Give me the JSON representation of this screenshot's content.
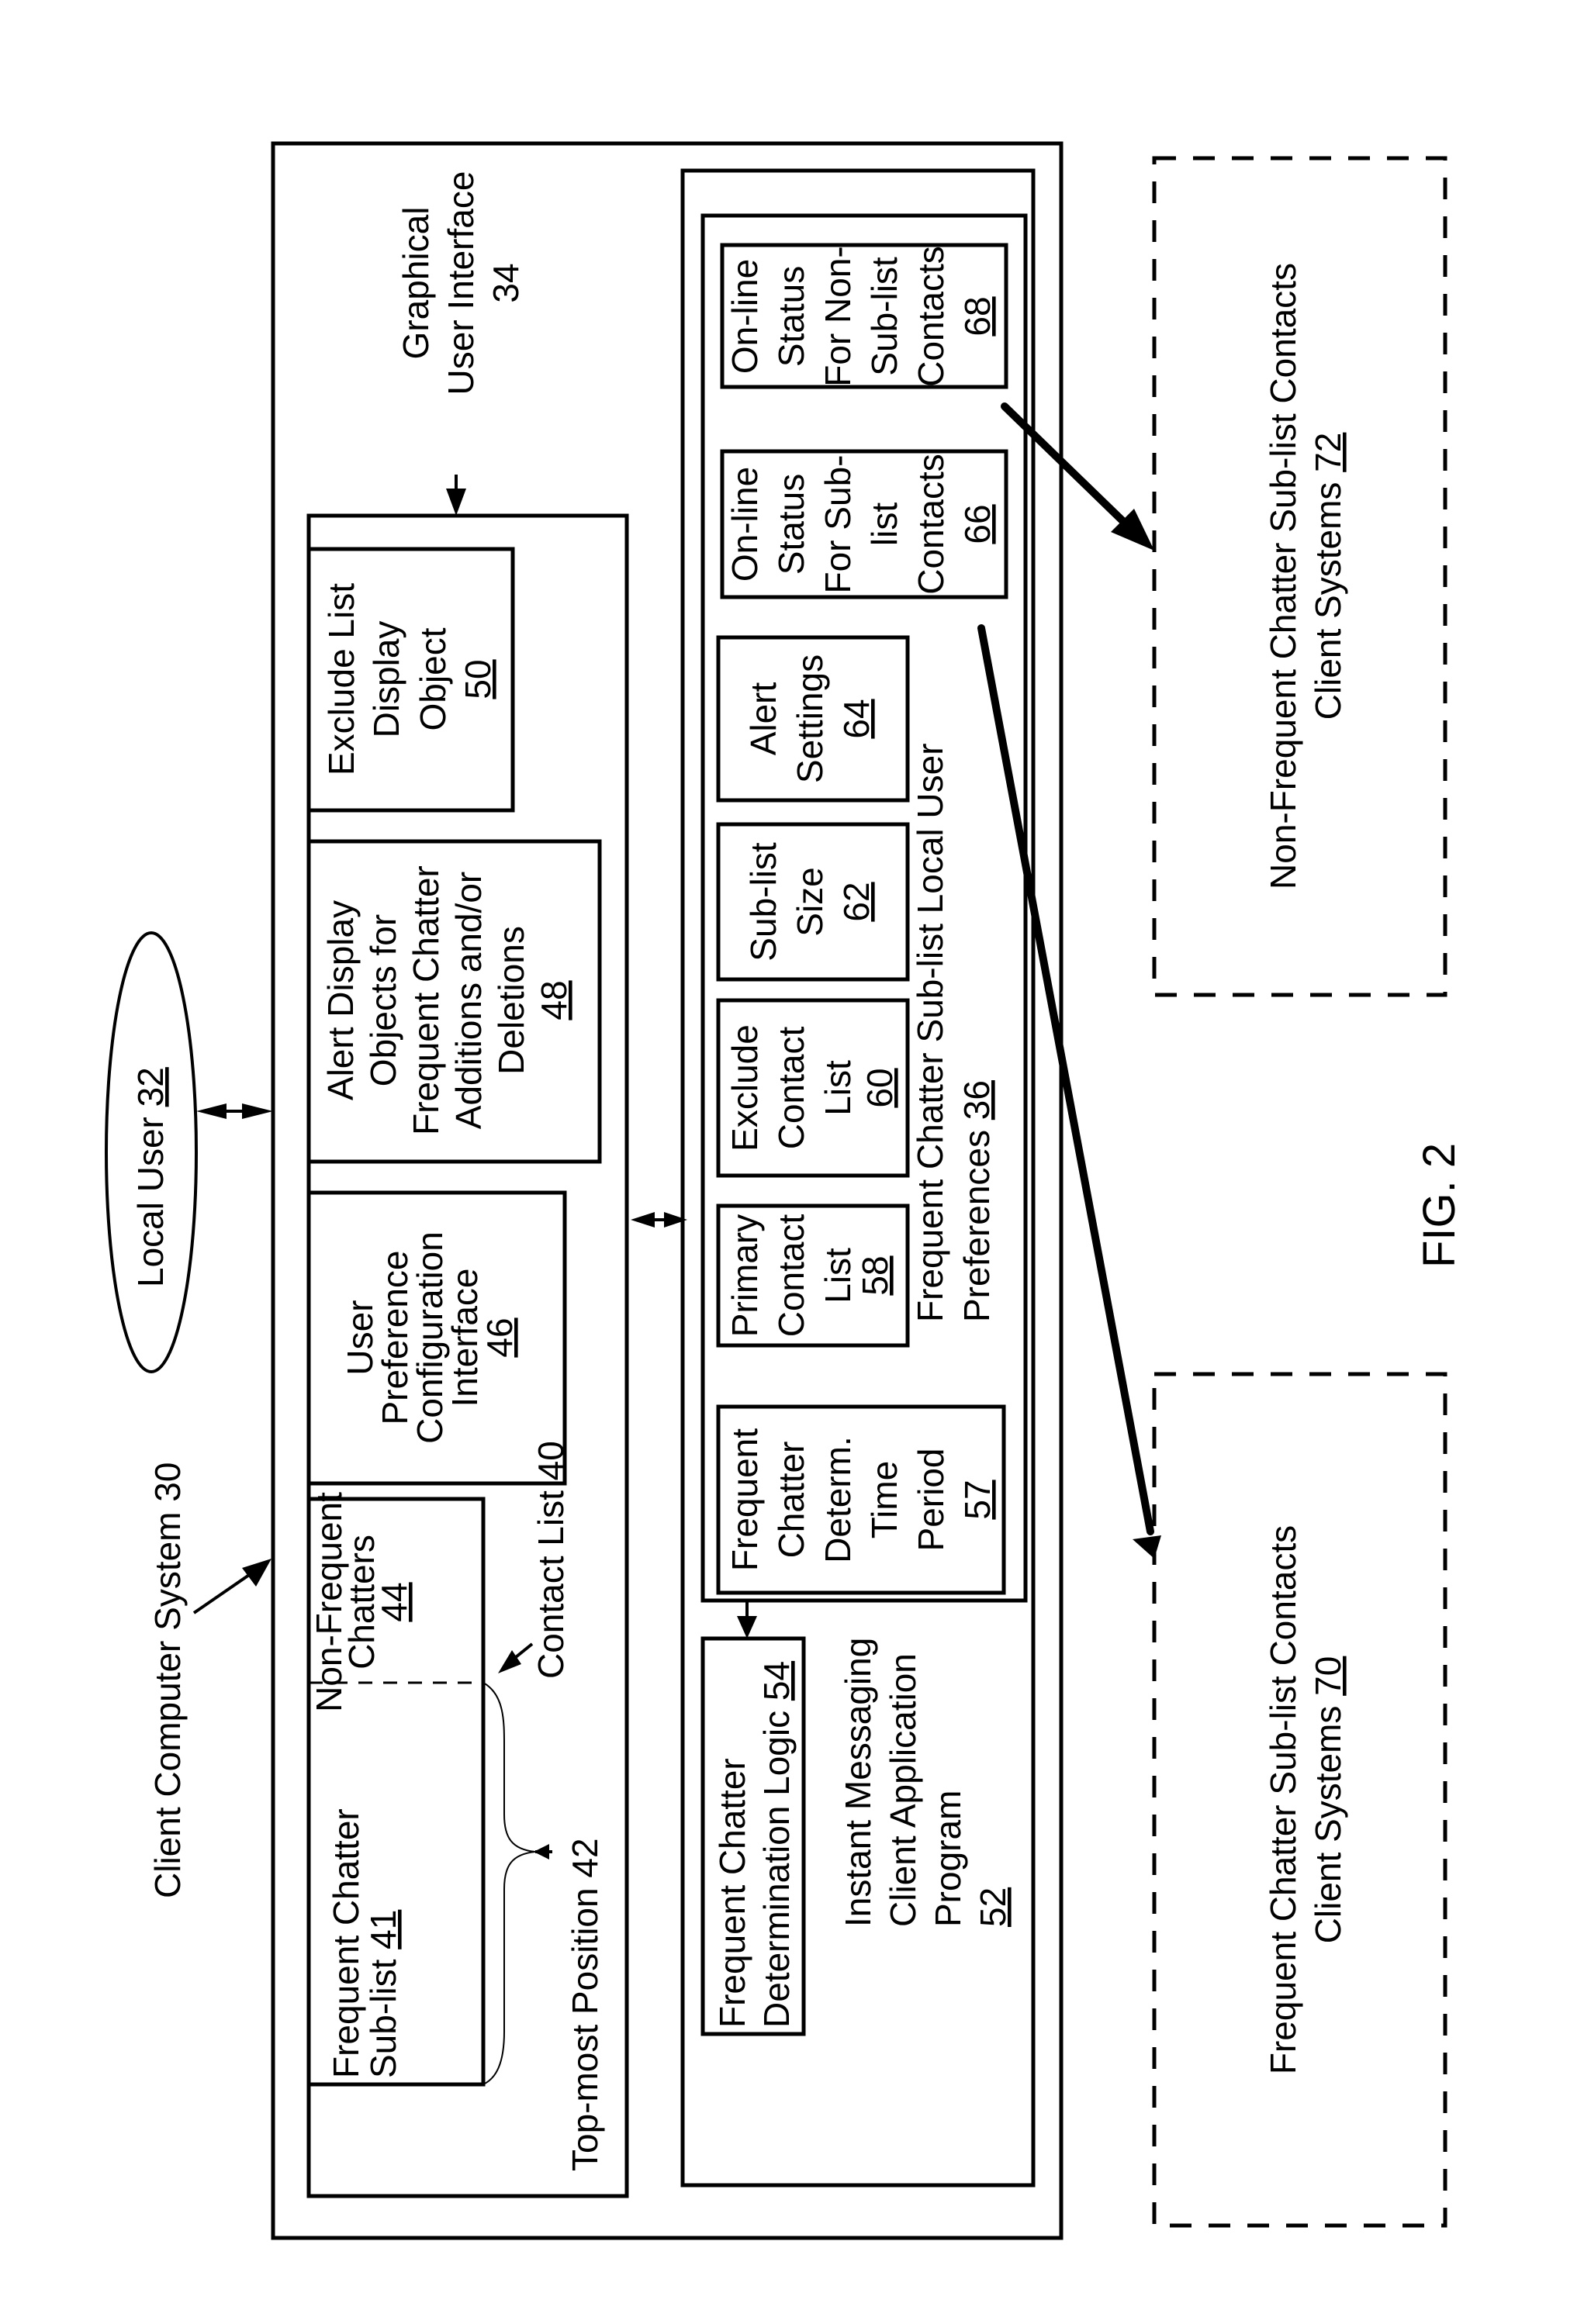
{
  "figure": {
    "label": "FIG. 2",
    "orientation": "rotated-90-ccw"
  },
  "client_computer_system": {
    "label": "Client Computer System 30"
  },
  "local_user": {
    "label": "Local User ",
    "ref": "32"
  },
  "gui": {
    "label_lines": [
      "Graphical",
      "User Interface",
      "34"
    ]
  },
  "contact_list": {
    "label": "Contact List 40",
    "top_most_position": "Top-most Position 42",
    "frequent_sublist": {
      "lines": [
        "Frequent Chatter",
        "Sub-list "
      ],
      "ref": "41"
    },
    "non_frequent": {
      "lines": [
        "Non-Frequent",
        "Chatters"
      ],
      "ref": "44"
    }
  },
  "user_pref_config": {
    "lines": [
      "User",
      "Preference",
      "Configuration",
      "Interface"
    ],
    "ref": "46"
  },
  "alert_display_objects": {
    "lines": [
      "Alert Display",
      "Objects for",
      "Frequent Chatter",
      "Additions and/or",
      "Deletions"
    ],
    "ref": "48"
  },
  "exclude_list_display": {
    "lines": [
      "Exclude List",
      "Display",
      "Object"
    ],
    "ref": "50"
  },
  "im_client_program": {
    "lines": [
      "Instant Messaging",
      "Client Application",
      "Program"
    ],
    "ref": "52"
  },
  "determination_logic": {
    "lines": [
      "Frequent Chatter",
      "Determination Logic "
    ],
    "ref": "54"
  },
  "preferences": {
    "lines": [
      "Frequent Chatter Sub-list Local User",
      "Preferences "
    ],
    "ref": "36",
    "items": [
      {
        "lines": [
          "Frequent",
          "Chatter",
          "Determ.",
          "Time",
          "Period"
        ],
        "ref": "57"
      },
      {
        "lines": [
          "Primary",
          "Contact",
          "List"
        ],
        "ref": "58"
      },
      {
        "lines": [
          "Exclude",
          "Contact",
          "List"
        ],
        "ref": "60"
      },
      {
        "lines": [
          "Sub-list",
          "Size"
        ],
        "ref": "62"
      },
      {
        "lines": [
          "Alert",
          "Settings"
        ],
        "ref": "64"
      }
    ]
  },
  "online_status_sublist": {
    "lines": [
      "On-line",
      "Status",
      "For Sub-",
      "list",
      "Contacts"
    ],
    "ref": "66"
  },
  "online_status_non_sublist": {
    "lines": [
      "On-line",
      "Status",
      "For Non-",
      "Sub-list",
      "Contacts"
    ],
    "ref": "68"
  },
  "frequent_client_systems": {
    "lines": [
      "Frequent Chatter Sub-list Contacts",
      "Client Systems "
    ],
    "ref": "70"
  },
  "non_frequent_client_systems": {
    "lines": [
      "Non-Frequent Chatter Sub-list Contacts",
      "Client Systems "
    ],
    "ref": "72"
  }
}
